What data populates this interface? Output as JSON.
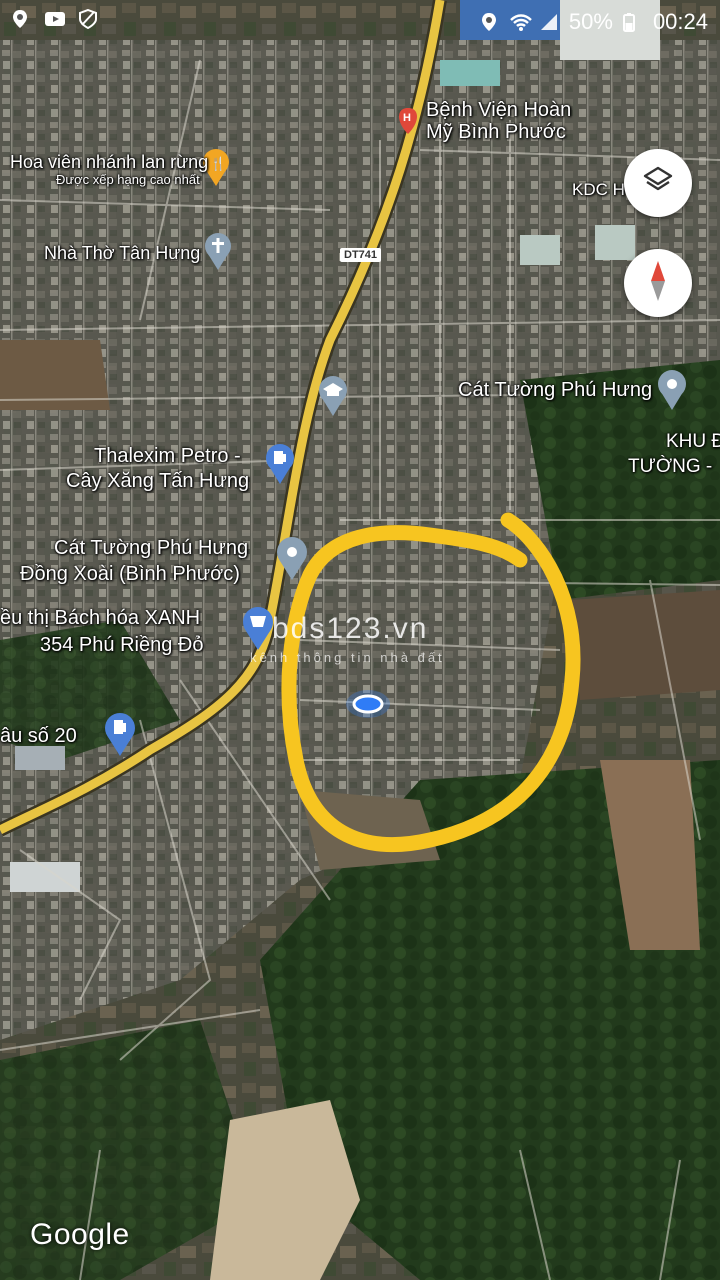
{
  "status_bar": {
    "battery": "50%",
    "time": "00:24"
  },
  "places": {
    "hospital": "Bệnh Viện Hoàn",
    "hospital_line2": "Mỹ Bình Phước",
    "park": "Hoa viên nhánh lan rừng",
    "park_sub": "Được xếp hạng cao nhất",
    "church": "Nhà Thờ Tân Hưng",
    "kdc": "KDC H",
    "road_badge": "DT741",
    "cat_tuong_right": "Cát Tường Phú Hưng",
    "khu_line1": "KHU Đ",
    "khu_line2": "TƯỜNG -",
    "petro_line1": "Thalexim Petro -",
    "petro_line2": "Cây Xăng Tấn Hưng",
    "cat_tuong_left_line1": "Cát Tường Phú Hưng",
    "cat_tuong_left_line2": "Đồng Xoài (Bình Phước)",
    "bach_hoa_line1": "ều thị Bách hóa XANH",
    "bach_hoa_line2": "354 Phú Riềng Đỏ",
    "cau_so": "âu số 20"
  },
  "watermark": {
    "main": "bds123.vn",
    "sub": "kênh thông tin nhà đất"
  },
  "map_attribution": "Google",
  "colors": {
    "highlight_circle": "#f7c520",
    "main_road": "#e8c442",
    "pin_blue": "#4a7fd6",
    "pin_gray": "#8aa0b4",
    "pin_orange": "#f2a623",
    "pin_red": "#e0483a",
    "location_dot": "#2f7cf6"
  },
  "icons": {
    "layers_button": "layers-icon",
    "compass_button": "compass-icon"
  }
}
